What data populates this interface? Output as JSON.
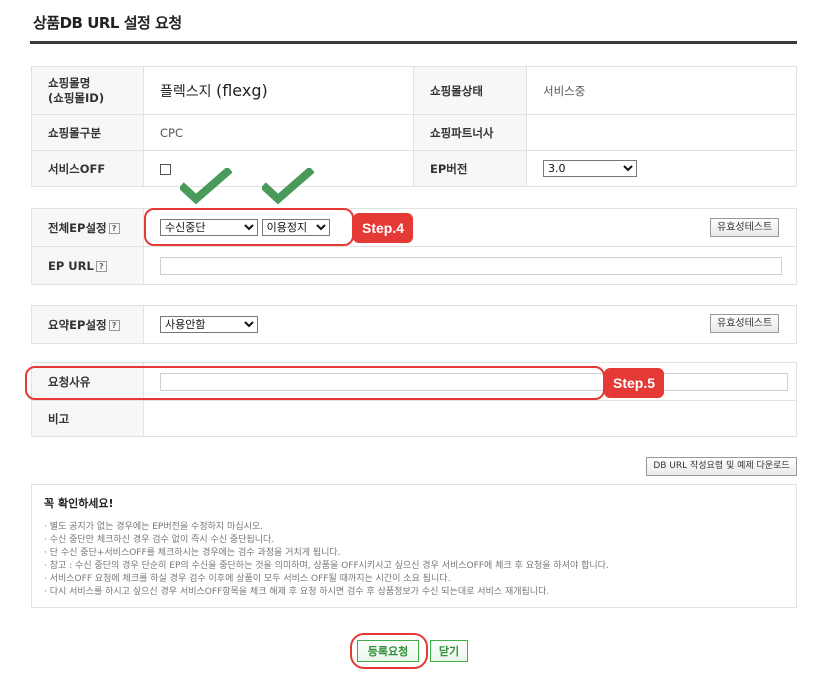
{
  "page": {
    "title": "상품DB URL 설정 요청"
  },
  "info": {
    "shop_name_label": "쇼핑몰명\n(쇼핑몰ID)",
    "shop_name_value": "플렉스지",
    "shop_id_value": "(flexg)",
    "shop_status_label": "쇼핑몰상태",
    "shop_status_value": "서비스중",
    "shop_type_label": "쇼핑몰구분",
    "shop_type_value": "CPC",
    "partner_label": "쇼핑파트너사",
    "partner_value": "",
    "service_off_label": "서비스OFF",
    "ep_version_label": "EP버전",
    "ep_version_value": "3.0"
  },
  "ep": {
    "full_label": "전체EP설정",
    "help": "?",
    "select1_value": "수신중단",
    "select2_value": "이용정지",
    "validate_button": "유효성테스트",
    "url_label": "EP URL",
    "url_value": ""
  },
  "summary": {
    "label": "요약EP설정",
    "select_value": "사용안함",
    "validate_button": "유효성테스트"
  },
  "request": {
    "reason_label": "요청사유",
    "reason_value": "",
    "note_label": "비고"
  },
  "guide_button": "DB URL 작성요령 및 예제 다운로드",
  "steps": {
    "step4": "Step.4",
    "step5": "Step.5"
  },
  "notice": {
    "title": "꼭 확인하세요!",
    "lines": [
      "· 별도 공지가 없는 경우에는 EP버전을 수정하지 마십시오.",
      "· 수신 중단만 체크하신 경우 검수 없이 즉시 수신 중단됩니다.",
      "· 단 수신 중단+서비스OFF를 체크하시는 경우에는 검수 과정을 거치게 됩니다.",
      "· 참고 : 수신 중단의 경우 단순히 EP의 수신을 중단하는 것을 의미하며, 상품을 OFF시키시고 싶으신 경우 서비스OFF에 체크 후 요청을 하셔야 합니다.",
      "· 서비스OFF 요청에 체크를 하실 경우 검수 이후에 상품이 모두 서비스 OFF될 때까지는 시간이 소요 됩니다.",
      "· 다시 서비스를 하시고 싶으신 경우 서비스OFF항목을 체크 해제 후 요청 하시면 검수 후 상품정보가 수신 되는대로 서비스 재개됩니다."
    ]
  },
  "buttons": {
    "register": "등록요청",
    "close": "닫기"
  },
  "colors": {
    "accent_red": "#e53935",
    "check_green": "#4a9a5c",
    "button_green": "#3fae4a"
  }
}
